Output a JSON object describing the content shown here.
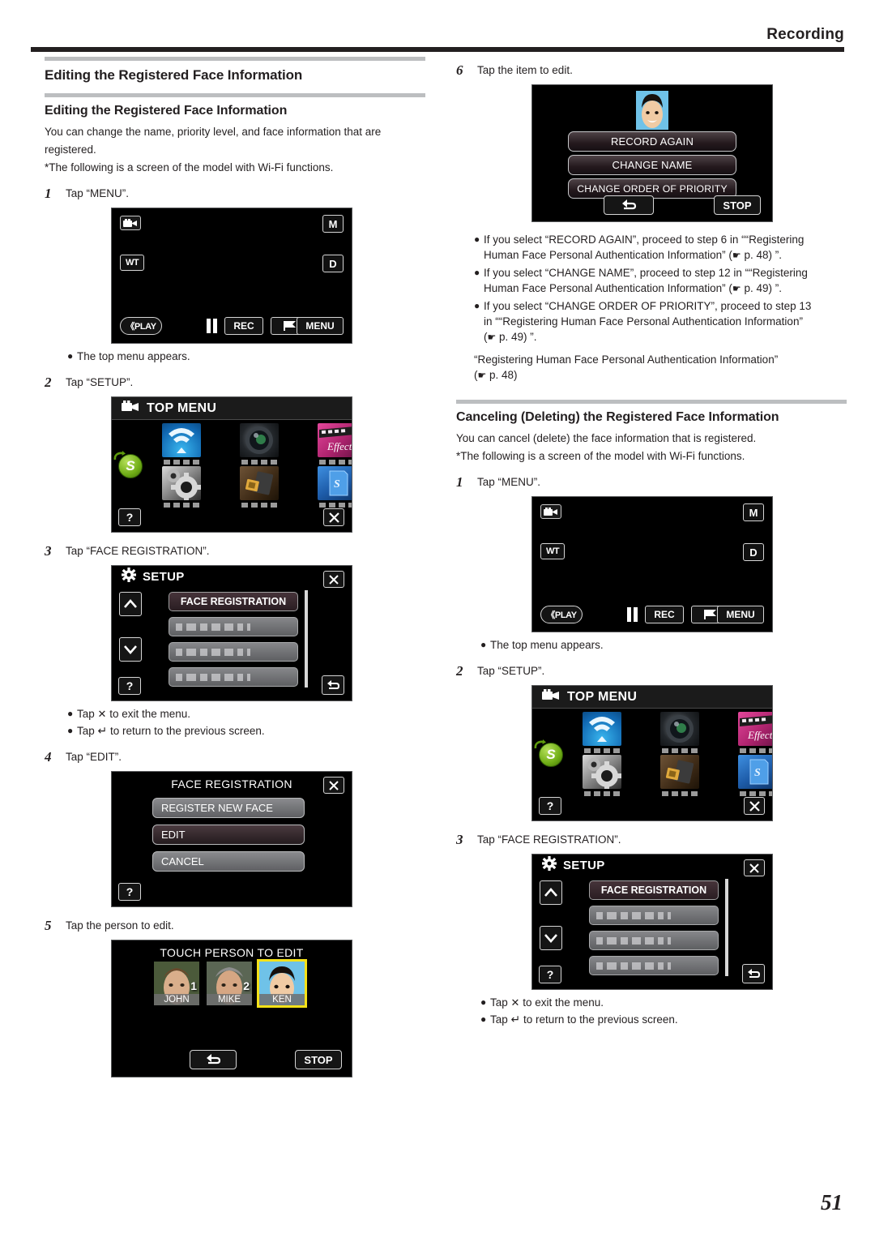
{
  "header": {
    "title": "Recording"
  },
  "page": {
    "number": "51"
  },
  "left": {
    "section_heading": "Editing the Registered Face Information",
    "sub_heading": "Editing the Registered Face Information",
    "intro_line1": "You can change the name, priority level, and face information that are",
    "intro_line2": "registered.",
    "intro_line3": "*The following is a screen of the model with Wi-Fi functions.",
    "steps": [
      {
        "num": "1",
        "text": "Tap “MENU”."
      },
      {
        "num": "2",
        "text": "Tap “SETUP”."
      },
      {
        "num": "3",
        "text": "Tap “FACE REGISTRATION”."
      },
      {
        "num": "4",
        "text": "Tap “EDIT”."
      },
      {
        "num": "5",
        "text": "Tap the person to edit."
      }
    ],
    "note_top_menu": "The top menu appears.",
    "note_exit_pre": "Tap",
    "note_exit_post": "to exit the menu.",
    "note_back_pre": "Tap",
    "note_back_post": "to return to the previous screen."
  },
  "right": {
    "step6": {
      "num": "6",
      "text": "Tap the item to edit."
    },
    "bullets": [
      {
        "line1": "If you select “RECORD AGAIN”, proceed to step 6 in ““Registering",
        "line2_a": "Human Face Personal Authentication Information” (",
        "line2_b": " p. 48) ”."
      },
      {
        "line1": "If you select “CHANGE NAME”, proceed to step 12 in ““Registering",
        "line2_a": "Human Face Personal Authentication Information” (",
        "line2_b": " p. 49) ”."
      },
      {
        "line1": "If you select “CHANGE ORDER OF PRIORITY”, proceed to step 13",
        "line2_a": "in ““Registering Human Face Personal Authentication Information”",
        "line2_b": "",
        "line3_b": " p. 49) ”."
      }
    ],
    "ref_line1": "“Registering Human Face Personal Authentication Information”",
    "ref_line2_b": " p. 48)",
    "section_heading": "Canceling (Deleting) the Registered Face Information",
    "intro_line1": "You can cancel (delete) the face information that is registered.",
    "intro_line2": "*The following is a screen of the model with Wi-Fi functions.",
    "steps": [
      {
        "num": "1",
        "text": "Tap “MENU”."
      },
      {
        "num": "2",
        "text": "Tap “SETUP”."
      },
      {
        "num": "3",
        "text": "Tap “FACE REGISTRATION”."
      }
    ],
    "note_top_menu": "The top menu appears.",
    "note_exit_pre": "Tap",
    "note_exit_post": "to exit the menu.",
    "note_back_pre": "Tap",
    "note_back_post": "to return to the previous screen."
  },
  "screens": {
    "record": {
      "wt": "WT",
      "mode_m": "M",
      "mode_d": "D",
      "play": "《PLAY",
      "rec": "REC",
      "menu": "MENU"
    },
    "top_menu": {
      "title": "TOP MENU",
      "help": "?",
      "s_badge": "S",
      "tiles": [
        {
          "name": "wifi-tile"
        },
        {
          "name": "lens-tile"
        },
        {
          "name": "effect-tile"
        },
        {
          "name": "gear-tile"
        },
        {
          "name": "usb-tile"
        },
        {
          "name": "sd-card-tile"
        }
      ]
    },
    "setup": {
      "title": "SETUP",
      "selected_row": "FACE REGISTRATION",
      "help": "?"
    },
    "face_registration": {
      "title": "FACE REGISTRATION",
      "buttons": [
        "REGISTER NEW FACE",
        "EDIT",
        "CANCEL"
      ],
      "help": "?"
    },
    "touch_person": {
      "title": "TOUCH PERSON TO EDIT",
      "people": [
        {
          "name": "JOHN",
          "badge": "1"
        },
        {
          "name": "MIKE",
          "badge": "2"
        },
        {
          "name": "KEN",
          "badge": ""
        }
      ],
      "stop": "STOP"
    },
    "edit_item": {
      "buttons": [
        "RECORD AGAIN",
        "CHANGE NAME",
        "CHANGE ORDER OF PRIORITY"
      ],
      "stop": "STOP"
    }
  },
  "colors": {
    "ink": "#231f20",
    "rule_grey": "#bcbec0",
    "highlight_yellow": "#f4e118"
  }
}
